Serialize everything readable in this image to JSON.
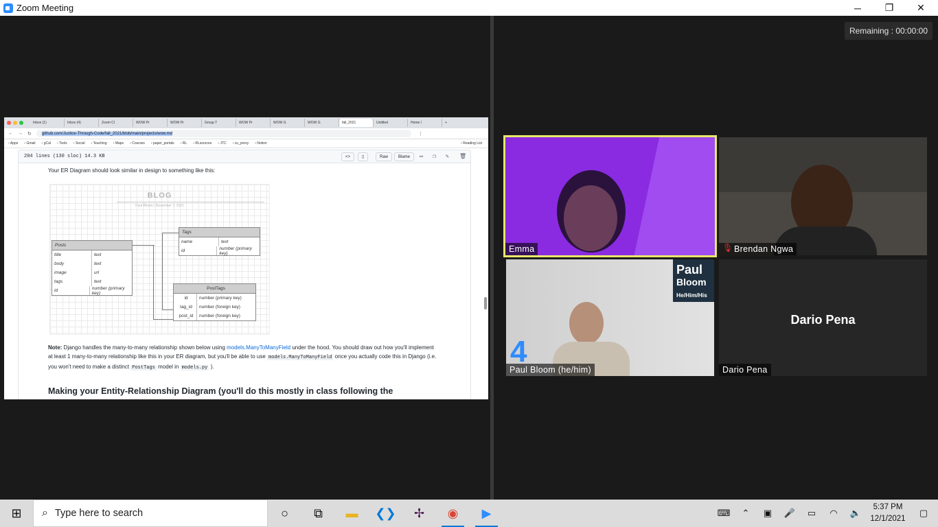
{
  "window": {
    "title": "Zoom Meeting",
    "minimize_glyph": "─",
    "restore_glyph": "❐",
    "close_glyph": "✕"
  },
  "meeting": {
    "remaining": "Remaining : 00:00:00"
  },
  "browser": {
    "tabs": [
      "Inbox (1)",
      "Inbox (4)",
      "Zoom Cl",
      "WOW Pr",
      "WOW Pr",
      "Group T",
      "WOW Pr",
      "WOW G",
      "WOW G",
      "fall_2021",
      "Untitled",
      "Home /"
    ],
    "new_tab_glyph": "+",
    "url": "github.com/Justice-Through-Code/fall_2021/blob/main/projects/wow.md",
    "bookmarks": [
      "Apps",
      "Gmail",
      "gCal",
      "Tools",
      "Social",
      "Teaching",
      "Maps",
      "Courses",
      "paper_portals",
      "RL",
      "RLsources",
      "JTC",
      "cu_proxy",
      "Notion"
    ],
    "reading_list": "Reading List"
  },
  "github": {
    "file_info": "204 lines (130 sloc)   14.3 KB",
    "raw_label": "Raw",
    "blame_label": "Blame",
    "intro": "Your ER Diagram should look similar in design to something like this:",
    "note_bold": "Note:",
    "note_1": " Django handles the many-to-many relationship shown below using ",
    "note_link": "models.ManyToManyField",
    "note_2": " under the hood. You should draw out how you'll implement at least 1 many-to-many relationship like this in your ER diagram, but you'll be able to use ",
    "note_code1": "models.ManyToManyField",
    "note_3": " once you actually code this in Django (i.e. you won't need to make a distinct ",
    "note_code2": "PostTags",
    "note_4": " model in ",
    "note_code3": "models.py",
    "note_5": " ).",
    "heading": "Making your Entity-Relationship Diagram (you'll do this mostly in class following the"
  },
  "er_diagram": {
    "title": "BLOG",
    "meta": "Paul Bloom   |   November 7, 2021",
    "posts": {
      "name": "Posts",
      "rows": [
        [
          "title",
          "text"
        ],
        [
          "body",
          "text"
        ],
        [
          "image",
          "url"
        ],
        [
          "tags",
          "text"
        ],
        [
          "id",
          "number (primary key)"
        ]
      ]
    },
    "tags": {
      "name": "Tags",
      "rows": [
        [
          "name",
          "text"
        ],
        [
          "id",
          "number (primary key)"
        ]
      ]
    },
    "posttags": {
      "name": "PostTags",
      "rows": [
        [
          "id",
          "number (primary key)"
        ],
        [
          "tag_id",
          "number (foreign key)"
        ],
        [
          "post_id",
          "number (foreign key)"
        ]
      ]
    }
  },
  "participants": [
    {
      "name": "Emma",
      "active_speaker": true,
      "bg": "#8a2be2"
    },
    {
      "name": "Brendan Ngwa",
      "muted": true
    },
    {
      "name": "Paul Bloom (he/him)",
      "bg_name_1": "Paul",
      "bg_name_2": "Bloom",
      "bg_pronouns": "He/Him/His"
    },
    {
      "name": "Dario Pena",
      "video_off": true
    }
  ],
  "taskbar": {
    "search_placeholder": "Type here to search",
    "time": "5:37 PM",
    "date": "12/1/2021"
  },
  "colors": {
    "zoom_blue": "#2d8cff",
    "active_speaker_border": "#e8e86a",
    "github_link": "#0969da"
  }
}
